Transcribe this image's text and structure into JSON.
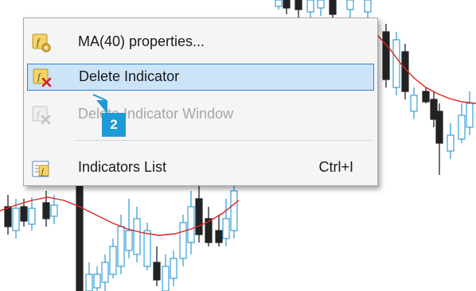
{
  "context_menu": {
    "items": [
      {
        "label": "MA(40) properties...",
        "icon": "indicator-properties-icon",
        "state": "normal"
      },
      {
        "label": "Delete Indicator",
        "icon": "delete-indicator-icon",
        "state": "highlighted"
      },
      {
        "label": "Delete Indicator Window",
        "icon": "delete-indicator-window-icon",
        "state": "disabled"
      },
      {
        "label": "Indicators List",
        "icon": "indicators-list-icon",
        "shortcut": "Ctrl+I",
        "state": "normal"
      }
    ]
  },
  "callout": {
    "number": "2"
  },
  "colors": {
    "menu_bg": "#f5f5f5",
    "highlight_bg": "#cce4f7",
    "highlight_border": "#2d83d4",
    "disabled_text": "#a6a6a6",
    "badge": "#1e9ad6",
    "ma_line": "#e02020",
    "candle_bull": "#3aa0d8",
    "candle_bear": "#222222"
  }
}
